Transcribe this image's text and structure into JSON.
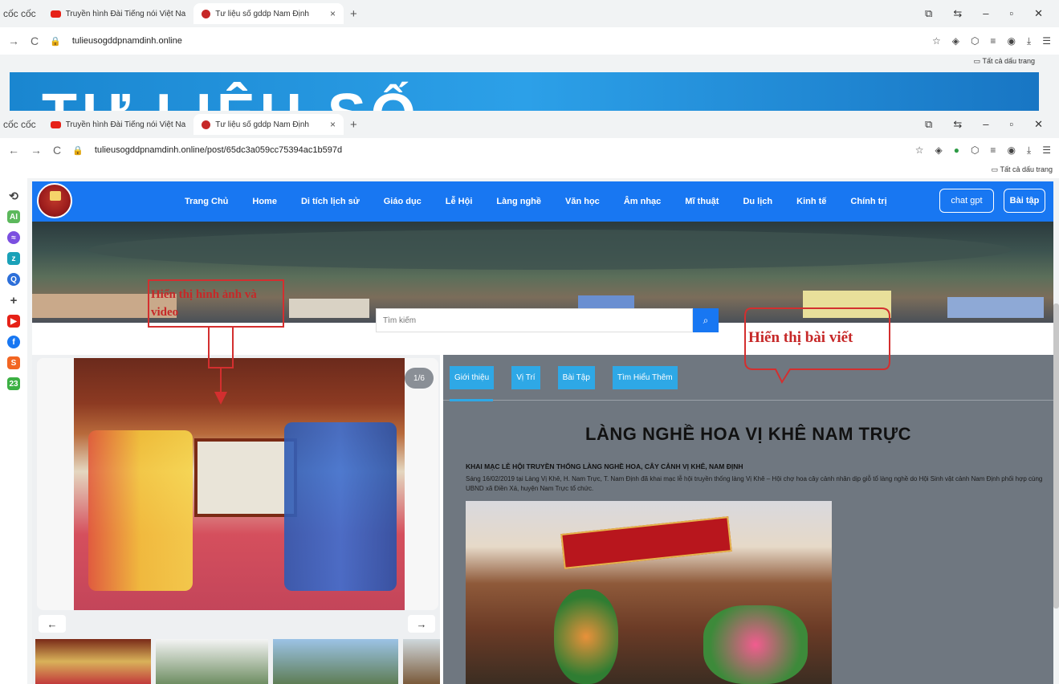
{
  "back_browser": {
    "brand": "cốc cốc",
    "tabs": [
      {
        "title": "Truyền hình Đài Tiếng nói Việt Na"
      },
      {
        "title": "Tư liệu số gddp Nam Định"
      }
    ],
    "url": "tulieusogddpnamdinh.online",
    "bookmarks_label": "Tất cả dấu trang",
    "banner_text": "TƯ LIỆU SỐ"
  },
  "front_browser": {
    "brand": "cốc cốc",
    "tabs": [
      {
        "title": "Truyền hình Đài Tiếng nói Việt Na"
      },
      {
        "title": "Tư liệu số gddp Nam Định"
      }
    ],
    "url": "tulieusogddpnamdinh.online/post/65dc3a059cc75394ac1b597d",
    "bookmarks_label": "Tất cả dấu trang"
  },
  "site": {
    "nav": [
      "Trang Chủ",
      "Home",
      "Di tích lịch sử",
      "Giáo dục",
      "Lễ Hội",
      "Làng nghề",
      "Văn học",
      "Âm nhạc",
      "Mĩ thuật",
      "Du lịch",
      "Kinh tế",
      "Chính trị"
    ],
    "chat_button": "chat gpt",
    "exercise_button": "Bài tập",
    "search_placeholder": "Tìm kiếm",
    "gallery": {
      "counter": "1/6",
      "prev": "←",
      "next": "→"
    },
    "content_tabs": [
      "Giới thiệu",
      "Vị Trí",
      "Bài Tập",
      "Tìm Hiểu Thêm"
    ],
    "article": {
      "title": "LÀNG NGHỀ HOA VỊ KHÊ NAM TRỰC",
      "subtitle": "KHAI MẠC LỄ HỘI TRUYỀN THỐNG LÀNG NGHỀ HOA, CÂY CẢNH VỊ KHÊ, NAM ĐỊNH",
      "body": "Sáng 16/02/2019 tại Làng Vị Khê, H. Nam Trực, T. Nam Định đã khai mạc lễ hội truyền thống làng Vị Khê – Hội chợ hoa cây cảnh nhân dịp giỗ tổ làng nghề do Hội Sinh vật cảnh Nam Định phối hợp cùng UBND xã Điền Xá, huyện Nam Trực tổ chức."
    }
  },
  "annotations": {
    "media_label": "Hiển thị hình ảnh và video",
    "article_label": "Hiển thị bài viết"
  },
  "colors": {
    "nav_blue": "#1877f2",
    "tab_blue": "#2ea8e6",
    "content_bg": "#6f7780",
    "annotation_red": "#d32f2f"
  }
}
